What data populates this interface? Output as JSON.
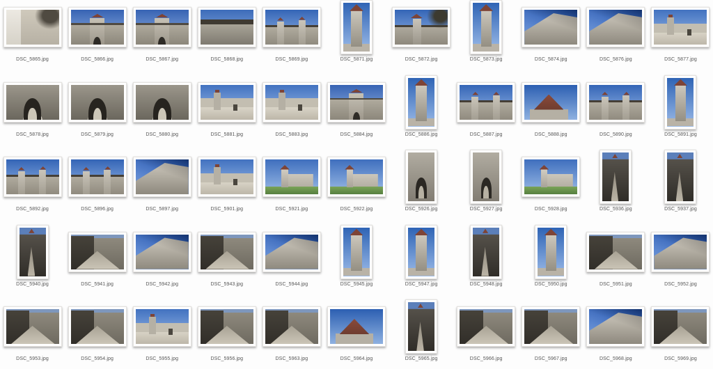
{
  "page": {
    "background_color": "#fdfdfd",
    "label_color": "#565656"
  },
  "palette": {
    "sky_blue": "#2f64b5",
    "sky_light": "#9cbbe8",
    "stone_light": "#cdc8bd",
    "stone_dark": "#6e6a60",
    "roof_red": "#7e4436",
    "shadow_dark": "#2c2a25",
    "grass_green": "#6f9a4e"
  },
  "grid": {
    "columns": 11,
    "rows": 5,
    "item_count": 55
  },
  "photos": [
    {
      "filename": "DSC_5865.jpg",
      "orientation": "landscape",
      "scene": "courtyard"
    },
    {
      "filename": "DSC_5866.jpg",
      "orientation": "landscape",
      "scene": "gatewall"
    },
    {
      "filename": "DSC_5867.jpg",
      "orientation": "landscape",
      "scene": "gatewall"
    },
    {
      "filename": "DSC_5868.jpg",
      "orientation": "landscape",
      "scene": "wallwalk"
    },
    {
      "filename": "DSC_5869.jpg",
      "orientation": "landscape",
      "scene": "walltowers"
    },
    {
      "filename": "DSC_5871.jpg",
      "orientation": "portrait",
      "scene": "towerp"
    },
    {
      "filename": "DSC_5872.jpg",
      "orientation": "landscape",
      "scene": "towertrees"
    },
    {
      "filename": "DSC_5873.jpg",
      "orientation": "portrait",
      "scene": "towerp"
    },
    {
      "filename": "DSC_5874.jpg",
      "orientation": "landscape",
      "scene": "upward"
    },
    {
      "filename": "DSC_5876.jpg",
      "orientation": "landscape",
      "scene": "upward"
    },
    {
      "filename": "DSC_5877.jpg",
      "orientation": "landscape",
      "scene": "street"
    },
    {
      "filename": "DSC_5878.jpg",
      "orientation": "landscape",
      "scene": "arch"
    },
    {
      "filename": "DSC_5879.jpg",
      "orientation": "landscape",
      "scene": "arch"
    },
    {
      "filename": "DSC_5880.jpg",
      "orientation": "landscape",
      "scene": "arch"
    },
    {
      "filename": "DSC_5881.jpg",
      "orientation": "landscape",
      "scene": "street"
    },
    {
      "filename": "DSC_5883.jpg",
      "orientation": "landscape",
      "scene": "street"
    },
    {
      "filename": "DSC_5884.jpg",
      "orientation": "landscape",
      "scene": "gatewall"
    },
    {
      "filename": "DSC_5886.jpg",
      "orientation": "portrait",
      "scene": "towerp"
    },
    {
      "filename": "DSC_5887.jpg",
      "orientation": "landscape",
      "scene": "walltowers"
    },
    {
      "filename": "DSC_5888.jpg",
      "orientation": "landscape",
      "scene": "skycone"
    },
    {
      "filename": "DSC_5890.jpg",
      "orientation": "landscape",
      "scene": "walltowers"
    },
    {
      "filename": "DSC_5891.jpg",
      "orientation": "portrait",
      "scene": "towerp"
    },
    {
      "filename": "DSC_5892.jpg",
      "orientation": "landscape",
      "scene": "walltowers"
    },
    {
      "filename": "DSC_5896.jpg",
      "orientation": "landscape",
      "scene": "walltowers"
    },
    {
      "filename": "DSC_5897.jpg",
      "orientation": "landscape",
      "scene": "upward"
    },
    {
      "filename": "DSC_5901.jpg",
      "orientation": "landscape",
      "scene": "street"
    },
    {
      "filename": "DSC_5921.jpg",
      "orientation": "landscape",
      "scene": "park"
    },
    {
      "filename": "DSC_5922.jpg",
      "orientation": "landscape",
      "scene": "park"
    },
    {
      "filename": "DSC_5926.jpg",
      "orientation": "portrait",
      "scene": "archp"
    },
    {
      "filename": "DSC_5927.jpg",
      "orientation": "portrait",
      "scene": "archp"
    },
    {
      "filename": "DSC_5928.jpg",
      "orientation": "landscape",
      "scene": "park"
    },
    {
      "filename": "DSC_5936.jpg",
      "orientation": "portrait",
      "scene": "alleyp"
    },
    {
      "filename": "DSC_5937.jpg",
      "orientation": "portrait",
      "scene": "alleyp"
    },
    {
      "filename": "DSC_5940.jpg",
      "orientation": "portrait",
      "scene": "alleyp"
    },
    {
      "filename": "DSC_5941.jpg",
      "orientation": "landscape",
      "scene": "alley"
    },
    {
      "filename": "DSC_5942.jpg",
      "orientation": "landscape",
      "scene": "upward"
    },
    {
      "filename": "DSC_5943.jpg",
      "orientation": "landscape",
      "scene": "alley"
    },
    {
      "filename": "DSC_5944.jpg",
      "orientation": "landscape",
      "scene": "upward"
    },
    {
      "filename": "DSC_5945.jpg",
      "orientation": "portrait",
      "scene": "towerp"
    },
    {
      "filename": "DSC_5947.jpg",
      "orientation": "portrait",
      "scene": "towerp"
    },
    {
      "filename": "DSC_5948.jpg",
      "orientation": "portrait",
      "scene": "alleyp"
    },
    {
      "filename": "DSC_5950.jpg",
      "orientation": "portrait",
      "scene": "towerp"
    },
    {
      "filename": "DSC_5951.jpg",
      "orientation": "landscape",
      "scene": "alley"
    },
    {
      "filename": "DSC_5952.jpg",
      "orientation": "landscape",
      "scene": "upward"
    },
    {
      "filename": "DSC_5953.jpg",
      "orientation": "landscape",
      "scene": "alley"
    },
    {
      "filename": "DSC_5954.jpg",
      "orientation": "landscape",
      "scene": "alley"
    },
    {
      "filename": "DSC_5955.jpg",
      "orientation": "landscape",
      "scene": "street"
    },
    {
      "filename": "DSC_5956.jpg",
      "orientation": "landscape",
      "scene": "alley"
    },
    {
      "filename": "DSC_5963.jpg",
      "orientation": "landscape",
      "scene": "alley"
    },
    {
      "filename": "DSC_5964.jpg",
      "orientation": "landscape",
      "scene": "skycone"
    },
    {
      "filename": "DSC_5965.jpg",
      "orientation": "portrait",
      "scene": "alleyp"
    },
    {
      "filename": "DSC_5966.jpg",
      "orientation": "landscape",
      "scene": "alley"
    },
    {
      "filename": "DSC_5967.jpg",
      "orientation": "landscape",
      "scene": "alley"
    },
    {
      "filename": "DSC_5968.jpg",
      "orientation": "landscape",
      "scene": "upward"
    },
    {
      "filename": "DSC_5969.jpg",
      "orientation": "landscape",
      "scene": "alley"
    }
  ]
}
